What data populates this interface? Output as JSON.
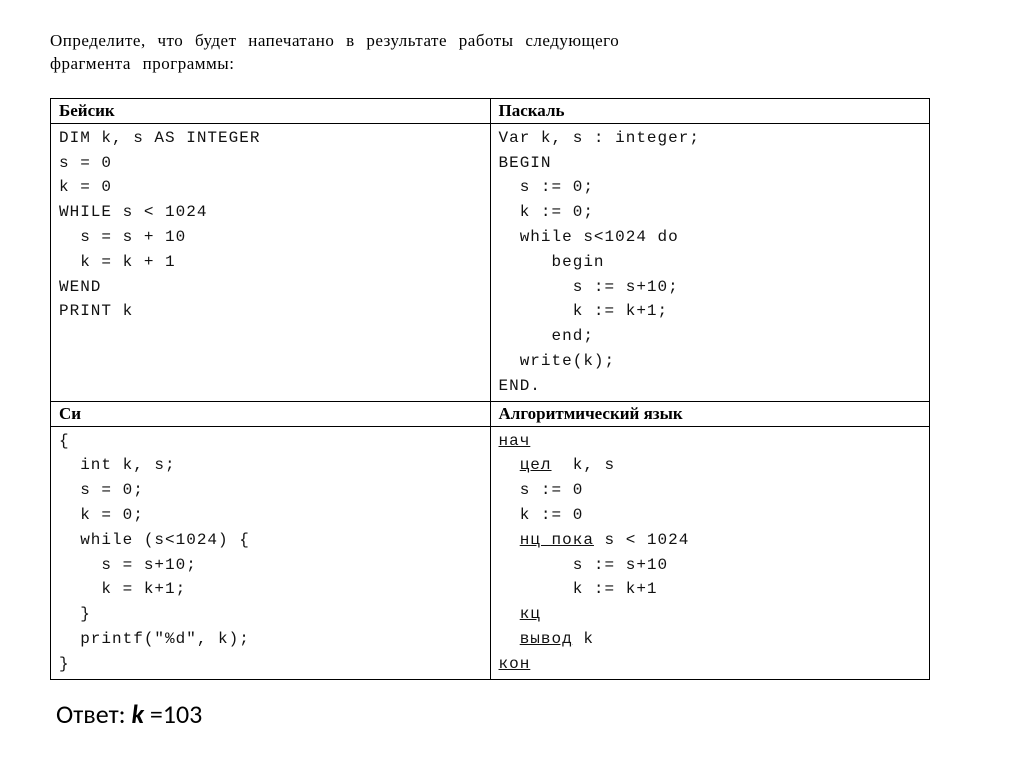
{
  "prompt_line1": "Определите, что будет напечатано в результате работы следующего",
  "prompt_line2": "фрагмента программы:",
  "headers": {
    "basic": "Бейсик",
    "pascal": "Паскаль",
    "c": "Си",
    "alg": "Алгоритмический язык"
  },
  "code": {
    "basic": "DIM k, s AS INTEGER\ns = 0\nk = 0\nWHILE s < 1024\n  s = s + 10\n  k = k + 1\nWEND\nPRINT k",
    "pascal": "Var k, s : integer;\nBEGIN\n  s := 0;\n  k := 0;\n  while s<1024 do\n     begin\n       s := s+10;\n       k := k+1;\n     end;\n  write(k);\nEND.",
    "c": "{\n  int k, s;\n  s = 0;\n  k = 0;\n  while (s<1024) {\n    s = s+10;\n    k = k+1;\n  }\n  printf(\"%d\", k);\n}",
    "alg_kw": {
      "nach": "нач",
      "tsel": "цел",
      "nts_poka": "нц пока",
      "kts": "кц",
      "vyvod": "вывод",
      "kon": "кон"
    },
    "alg_vars": "  k, s",
    "alg_l3": "  s := 0",
    "alg_l4": "  k := 0",
    "alg_cond": " s < 1024",
    "alg_l6": "       s := s+10",
    "alg_l7": "       k := k+1",
    "alg_out": " k"
  },
  "answer_label": "Ответ: ",
  "answer_var": "k",
  "answer_val": " =103"
}
